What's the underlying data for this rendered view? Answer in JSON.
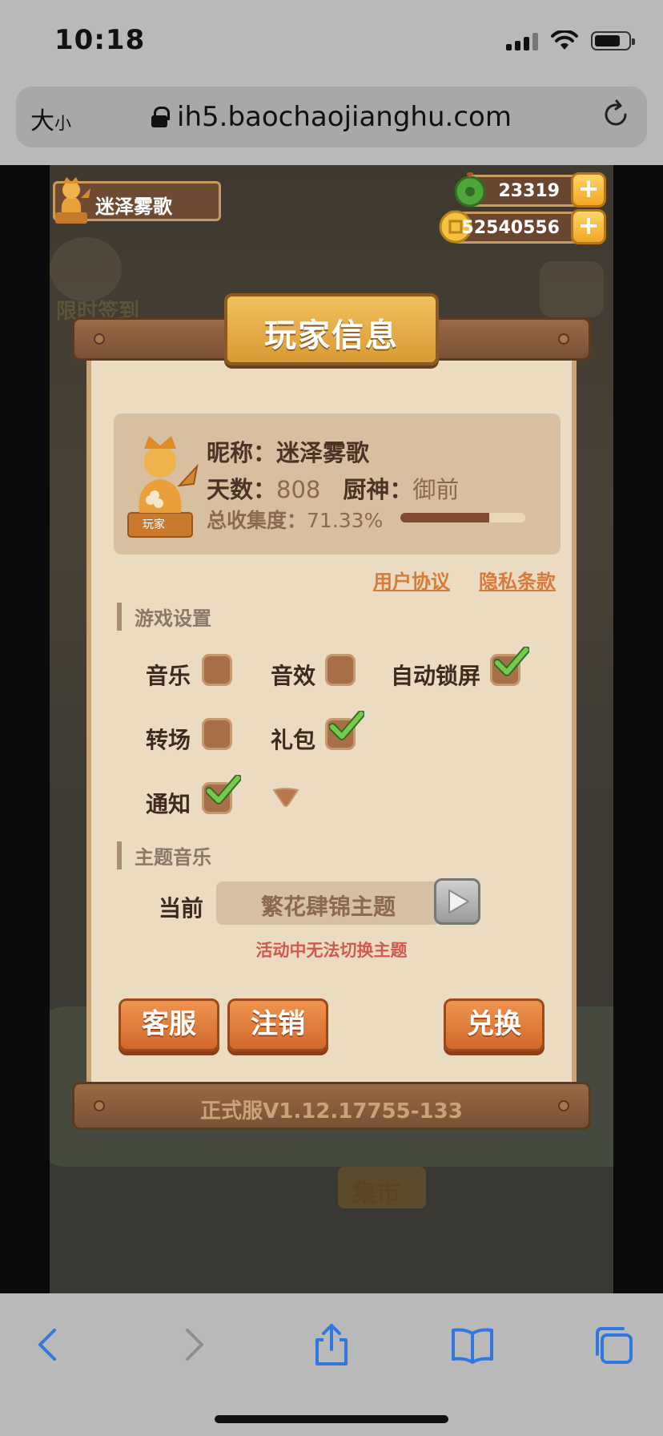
{
  "status_bar": {
    "time": "10:18"
  },
  "address_bar": {
    "text_size_big": "大",
    "text_size_small": "小",
    "url": "ih5.baochaojianghu.com"
  },
  "game": {
    "player_name": "迷泽雾歌",
    "jade": "23319",
    "coins": "52540556",
    "bg_labels": {
      "sign_in": "限时签到",
      "market": "集市"
    }
  },
  "modal": {
    "title": "玩家信息",
    "profile": {
      "nickname_label": "昵称：",
      "nickname": "迷泽雾歌",
      "days_label": "天数：",
      "days": "808",
      "chef_label": "厨神：",
      "chef": "御前",
      "collection_label": "总收集度：",
      "collection": "71.33%",
      "collection_ratio": 0.7133,
      "badge": "玩家"
    },
    "links": {
      "user_agreement": "用户协议",
      "privacy": "隐私条款"
    },
    "game_settings": {
      "heading": "游戏设置",
      "items": [
        {
          "label": "音乐",
          "checked": false
        },
        {
          "label": "音效",
          "checked": false
        },
        {
          "label": "自动锁屏",
          "checked": true
        },
        {
          "label": "转场",
          "checked": false
        },
        {
          "label": "礼包",
          "checked": true
        },
        {
          "label": "通知",
          "checked": true
        }
      ]
    },
    "theme_music": {
      "heading": "主题音乐",
      "current_label": "当前",
      "current": "繁花肆锦主题",
      "note": "活动中无法切换主题"
    },
    "buttons": {
      "support": "客服",
      "logout": "注销",
      "redeem": "兑换"
    },
    "version": "正式服V1.12.17755-133"
  },
  "colors": {
    "accent": "#d2682c",
    "link": "#d97a3a",
    "check": "#6fc04a",
    "warning": "#cf5a4e"
  },
  "icons": [
    "lock-icon",
    "reload-icon",
    "back-icon",
    "forward-icon",
    "share-icon",
    "bookmarks-icon",
    "tabs-icon",
    "checkmark-icon",
    "play-icon",
    "plus-icon",
    "jade-icon",
    "coin-icon"
  ]
}
